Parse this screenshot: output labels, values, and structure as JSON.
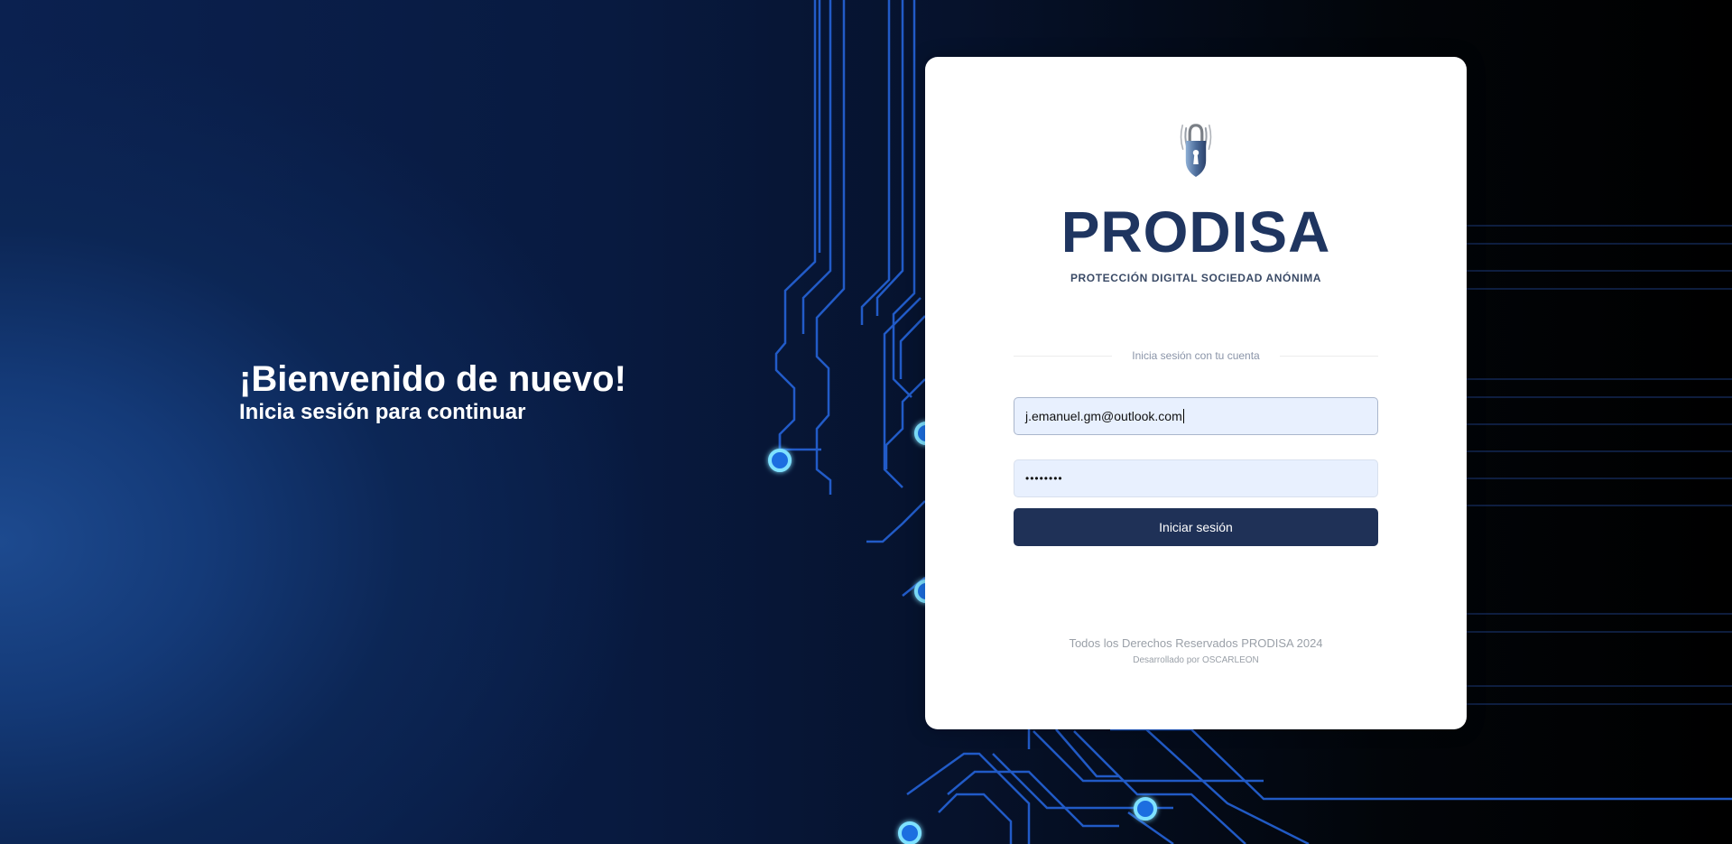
{
  "welcome": {
    "title": "¡Bienvenido de nuevo!",
    "subtitle": "Inicia sesión para continuar"
  },
  "logo": {
    "name": "PRODISA",
    "tagline": "PROTECCIÓN DIGITAL SOCIEDAD ANÓNIMA",
    "icon": "padlock-wifi-icon"
  },
  "login": {
    "divider_text": "Inicia sesión con tu cuenta",
    "email_value": "j.emanuel.gm@outlook.com",
    "password_masked": "••••••••",
    "submit_label": "Iniciar sesión"
  },
  "footer": {
    "rights": "Todos los Derechos Reservados PRODISA 2024",
    "developer": "Desarrollado por OSCARLEON"
  },
  "colors": {
    "brand_navy": "#1f3157",
    "input_bg": "#e8f0fe",
    "background_blue": "#143a78",
    "circuit_glow": "#26c6ff"
  }
}
